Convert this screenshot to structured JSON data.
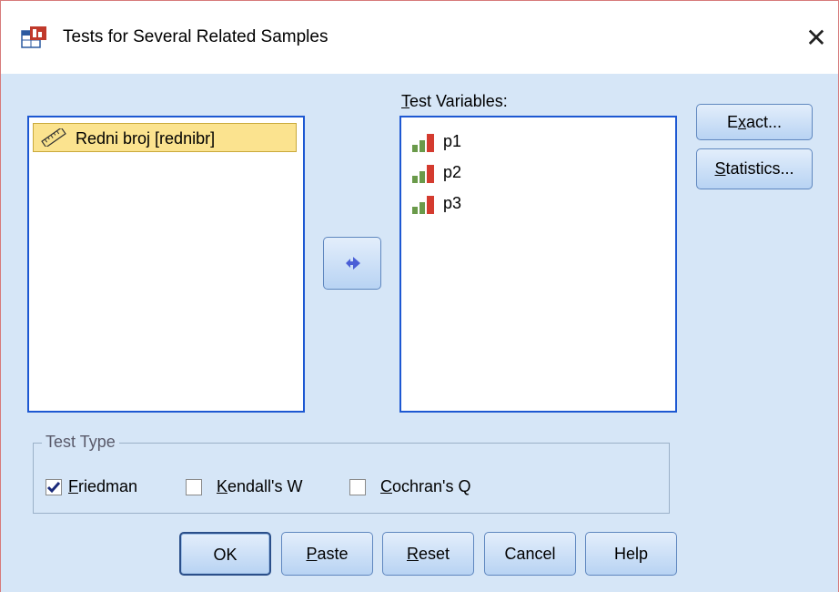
{
  "window": {
    "title": "Tests for Several Related Samples",
    "close_glyph": "✕"
  },
  "source_list": {
    "items": [
      {
        "label": "Redni broj [rednibr]",
        "icon": "ruler-icon"
      }
    ]
  },
  "target_list": {
    "label_prefix": "T",
    "label_rest": "est Variables:",
    "items": [
      {
        "label": "p1",
        "icon": "ordinal-bar-icon"
      },
      {
        "label": "p2",
        "icon": "ordinal-bar-icon"
      },
      {
        "label": "p3",
        "icon": "ordinal-bar-icon"
      }
    ]
  },
  "side_buttons": {
    "exact": {
      "pre": "E",
      "mnemonic": "x",
      "post": "act..."
    },
    "statistics": {
      "mnemonic": "S",
      "post": "tatistics..."
    }
  },
  "test_type": {
    "title": "Test Type",
    "options": [
      {
        "mnemonic": "F",
        "rest": "riedman",
        "checked": true
      },
      {
        "mnemonic": "K",
        "rest": "endall's W",
        "checked": false
      },
      {
        "mnemonic": "C",
        "rest": "ochran's Q",
        "checked": false
      }
    ]
  },
  "buttons": {
    "ok": "OK",
    "paste": {
      "mnemonic": "P",
      "rest": "aste"
    },
    "reset": {
      "mnemonic": "R",
      "rest": "eset"
    },
    "cancel": "Cancel",
    "help": "Help"
  },
  "colors": {
    "dialog_bg": "#d6e6f7",
    "list_border": "#1d58d2",
    "selected_item": "#fbe38f",
    "move_arrow": "#4a5fd6"
  }
}
